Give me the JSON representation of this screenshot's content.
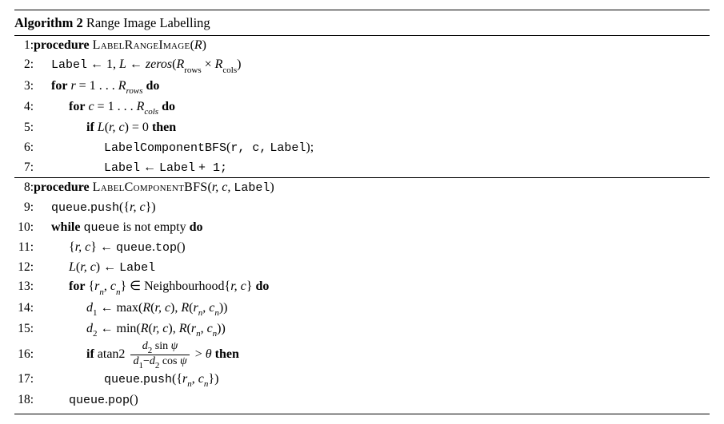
{
  "header": {
    "word": "Algorithm",
    "num": "2",
    "title": "Range Image Labelling"
  },
  "lines": {
    "l1": {
      "n": "1:",
      "kw": "procedure",
      "name": "LabelRangeImage",
      "arg": "R"
    },
    "l2": {
      "n": "2:",
      "a": "Label",
      "arrow": "←",
      "b": "1,",
      "c": "L",
      "d": "zeros",
      "e": "R",
      "f": "rows",
      "g": "R",
      "h": "cols"
    },
    "l3": {
      "n": "3:",
      "kw": "for",
      "a": "r",
      "eq": "= 1 . . .",
      "b": "R",
      "sub": "rows",
      "kw2": "do"
    },
    "l4": {
      "n": "4:",
      "kw": "for",
      "a": "c",
      "eq": "= 1 . . .",
      "b": "R",
      "sub": "cols",
      "kw2": "do"
    },
    "l5": {
      "n": "5:",
      "kw": "if",
      "a": "L",
      "b": "r, c",
      "c": "= 0",
      "kw2": "then"
    },
    "l6": {
      "n": "6:",
      "fn": "LabelComponentBFS",
      "args": "r, c,",
      "lbl": "Label",
      "semi": ";"
    },
    "l7": {
      "n": "7:",
      "a": "Label",
      "arrow": "←",
      "b": "Label",
      "c": "+ 1;"
    },
    "l8": {
      "n": "8:",
      "kw": "procedure",
      "name": "LabelComponentBFS",
      "args": "r, c,",
      "lbl": "Label"
    },
    "l9": {
      "n": "9:",
      "q": "queue",
      "p": "push",
      "a": "r, c"
    },
    "l10": {
      "n": "10:",
      "kw": "while",
      "q": "queue",
      "txt": "is not empty",
      "kw2": "do"
    },
    "l11": {
      "n": "11:",
      "a": "r, c",
      "arrow": "←",
      "q": "queue",
      "p": "top"
    },
    "l12": {
      "n": "12:",
      "a": "L",
      "b": "r, c",
      "arrow": "←",
      "lbl": "Label"
    },
    "l13": {
      "n": "13:",
      "kw": "for",
      "a": "r",
      "an": "n",
      "b": "c",
      "bn": "n",
      "in": "∈",
      "nb": "Neighbourhood",
      "c": "r, c",
      "kw2": "do"
    },
    "l14": {
      "n": "14:",
      "d": "d",
      "dn": "1",
      "arrow": "←",
      "fn": "max",
      "a": "R",
      "b": "r, c",
      "c": "R",
      "e": "r",
      "en": "n",
      "f": "c",
      "fn2": "n"
    },
    "l15": {
      "n": "15:",
      "d": "d",
      "dn": "2",
      "arrow": "←",
      "fn": "min",
      "a": "R",
      "b": "r, c",
      "c": "R",
      "e": "r",
      "en": "n",
      "f": "c",
      "fn2": "n"
    },
    "l16": {
      "n": "16:",
      "kw": "if",
      "fn": "atan2",
      "num_a": "d",
      "num_an": "2",
      "num_b": "sin",
      "num_c": "ψ",
      "den_a": "d",
      "den_an": "1",
      "den_b": "d",
      "den_bn": "2",
      "den_c": "cos",
      "den_d": "ψ",
      "gt": ">",
      "theta": "θ",
      "kw2": "then"
    },
    "l17": {
      "n": "17:",
      "q": "queue",
      "p": "push",
      "a": "r",
      "an": "n",
      "b": "c",
      "bn": "n"
    },
    "l18": {
      "n": "18:",
      "q": "queue",
      "p": "pop"
    }
  }
}
